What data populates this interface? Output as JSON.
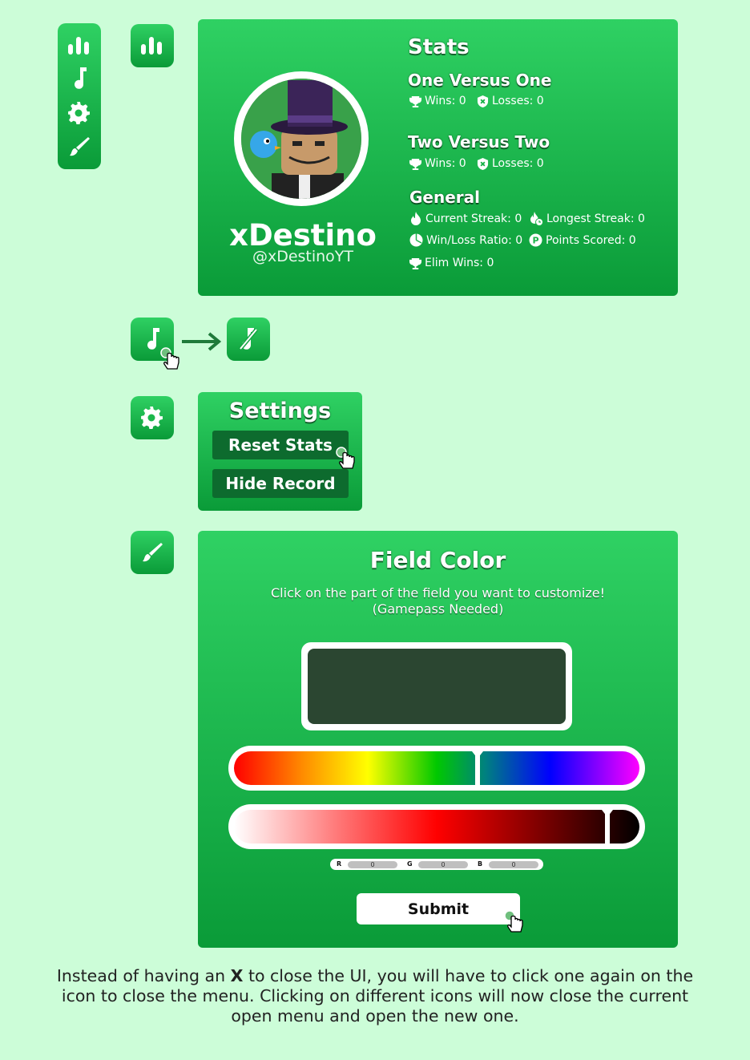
{
  "colors": {
    "background": "#ccfdd8",
    "green_light": "#2fd163",
    "green_dark": "#0a9b38",
    "button_dark": "#0d6b2e",
    "field_preview": "#2b4631"
  },
  "sidebar": {
    "icons": [
      "stats-icon",
      "music-icon",
      "gear-icon",
      "brush-icon"
    ]
  },
  "profile": {
    "display_name": "xDestino",
    "username": "@xDestinoYT"
  },
  "stats": {
    "title": "Stats",
    "one_v_one": {
      "title": "One Versus One",
      "wins": "Wins: 0",
      "losses": "Losses: 0"
    },
    "two_v_two": {
      "title": "Two Versus Two",
      "wins": "Wins: 0",
      "losses": "Losses: 0"
    },
    "general": {
      "title": "General",
      "current_streak": "Current Streak: 0",
      "longest_streak": "Longest Streak: 0",
      "win_loss_ratio": "Win/Loss Ratio: 0",
      "points_scored": "Points Scored: 0",
      "elim_wins": "Elim Wins: 0"
    }
  },
  "settings": {
    "title": "Settings",
    "reset_label": "Reset Stats",
    "hide_label": "Hide Record"
  },
  "field_color": {
    "title": "Field Color",
    "instruction": "Click on the part of the field you want to customize!",
    "note": "(Gamepass Needed)",
    "hue_position": 0.6,
    "shade_position": 0.92,
    "rgb": {
      "r_label": "R",
      "g_label": "G",
      "b_label": "B",
      "r": "0",
      "g": "0",
      "b": "0"
    },
    "submit_label": "Submit"
  },
  "caption": {
    "before": "Instead of having an ",
    "bold": "X",
    "after": " to close the UI, you will have to click one again on the icon to close the menu. Clicking on different icons will now close the current open menu and open the new one."
  }
}
